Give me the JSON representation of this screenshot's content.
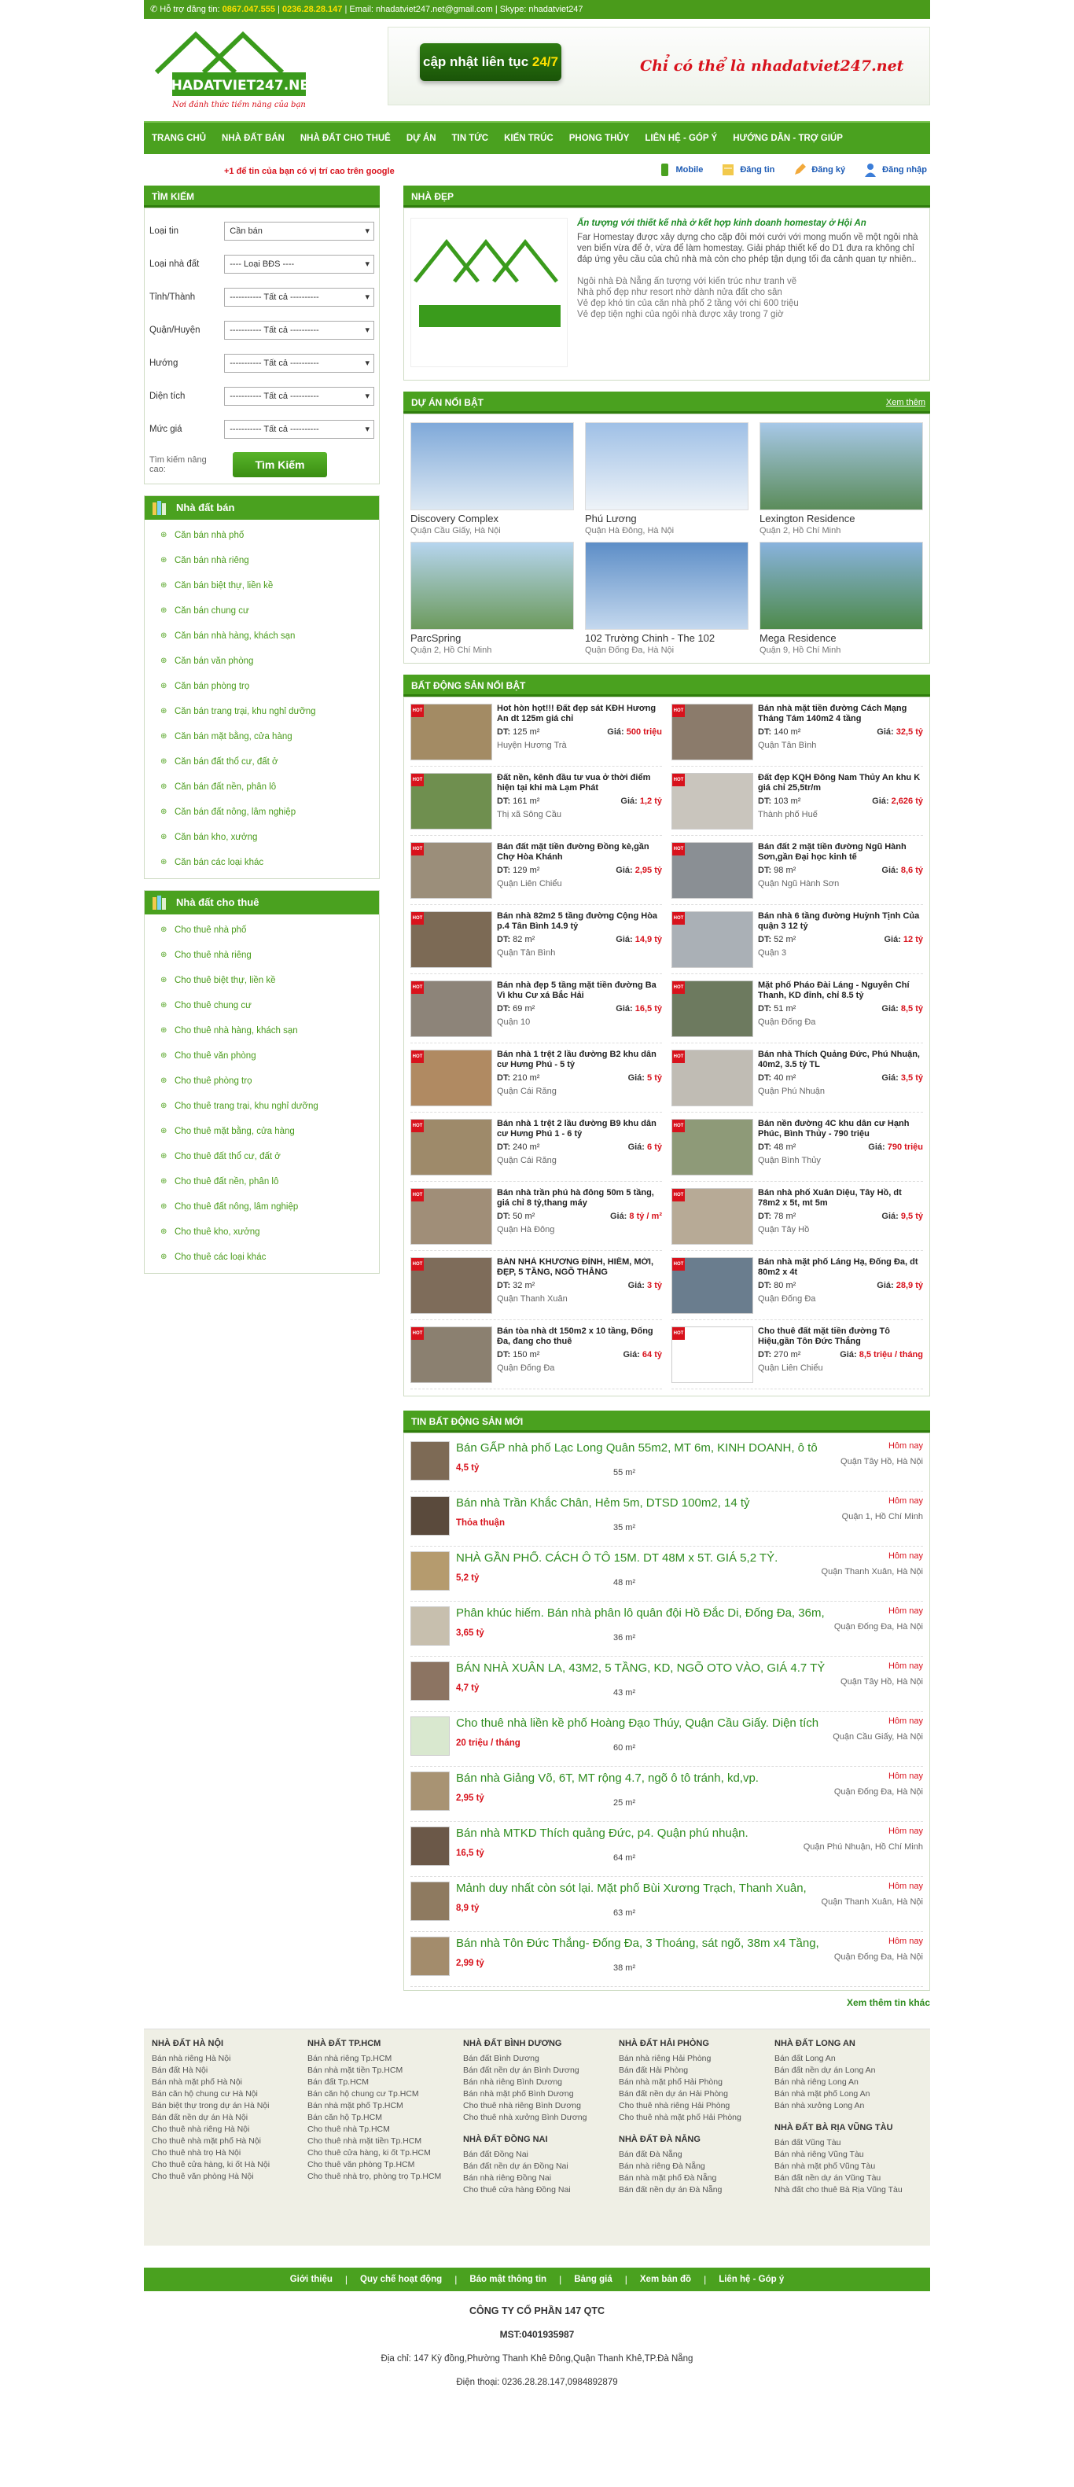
{
  "topbar": {
    "support_label": "Hỗ trợ đăng tin:",
    "phone1": "0867.047.555",
    "sep": "|",
    "phone2": "0236.28.28.147",
    "email": "| Email: nhadatviet247.net@gmail.com",
    "skype": "| Skype: nhadatviet247"
  },
  "header": {
    "logo_text": "NHADATVIET247.NET",
    "logo_tag": "Nơi đánh thức tiềm năng của bạn",
    "banner_btn_prefix": "cập nhật liên tục",
    "banner_btn_hl": "24/7",
    "banner_slogan": "Chỉ có thể là nhadatviet247.net"
  },
  "nav": [
    "TRANG CHỦ",
    "NHÀ ĐẤT BÁN",
    "NHÀ ĐẤT CHO THUÊ",
    "DỰ ÁN",
    "TIN TỨC",
    "KIẾN TRÚC",
    "PHONG THỦY",
    "LIÊN HỆ - GÓP Ý",
    "HƯỚNG DẪN - TRỢ GIÚP"
  ],
  "subbar": {
    "gplus": "+1 để tin của bạn có vị trí cao trên google",
    "mobile": "Mobile",
    "post": "Đăng tin",
    "register": "Đăng ký",
    "login": "Đăng nhập"
  },
  "search": {
    "title": "TÌM KIẾM",
    "rows": [
      {
        "label": "Loại tin",
        "value": "Cần bán"
      },
      {
        "label": "Loại nhà đất",
        "value": "---- Loại BĐS ----"
      },
      {
        "label": "Tỉnh/Thành",
        "value": "----------- Tất cả ----------"
      },
      {
        "label": "Quận/Huyện",
        "value": "----------- Tất cả ----------"
      },
      {
        "label": "Hướng",
        "value": "----------- Tất cả ----------"
      },
      {
        "label": "Diện tích",
        "value": "----------- Tất cả ----------"
      },
      {
        "label": "Mức giá",
        "value": "----------- Tất cả ----------"
      }
    ],
    "advanced": "Tìm kiếm nâng cao:",
    "button": "Tìm Kiếm"
  },
  "sale_cat": {
    "title": "Nhà đất bán",
    "items": [
      "Căn bán nhà phố",
      "Căn bán nhà riêng",
      "Căn bán biệt thự, liền kề",
      "Căn bán chung cư",
      "Căn bán nhà hàng, khách sạn",
      "Căn bán văn phòng",
      "Căn bán phòng trọ",
      "Căn bán trang trại, khu nghỉ dưỡng",
      "Căn bán mặt bằng, cửa hàng",
      "Căn bán đất thổ cư, đất ở",
      "Căn bán đất nền, phân lô",
      "Căn bán đất nông, lâm nghiệp",
      "Căn bán kho, xưởng",
      "Căn bán các loại khác"
    ]
  },
  "rent_cat": {
    "title": "Nhà đất cho thuê",
    "items": [
      "Cho thuê nhà phố",
      "Cho thuê nhà riêng",
      "Cho thuê biệt thự, liền kề",
      "Cho thuê chung cư",
      "Cho thuê nhà hàng, khách sạn",
      "Cho thuê văn phòng",
      "Cho thuê phòng trọ",
      "Cho thuê trang trại, khu nghỉ dưỡng",
      "Cho thuê mặt bằng, cửa hàng",
      "Cho thuê đất thổ cư, đất ở",
      "Cho thuê đất nền, phân lô",
      "Cho thuê đất nông, lâm nghiệp",
      "Cho thuê kho, xưởng",
      "Cho thuê các loại khác"
    ]
  },
  "featured": {
    "title": "NHÀ ĐẸP",
    "headline": "Ấn tượng với thiết kế nhà ở kết hợp kinh doanh homestay ở Hội An",
    "body": "Far Homestay được xây dựng cho cặp đôi mới cưới với mong muốn về một ngôi nhà ven biển vừa để ở, vừa để làm homestay. Giải pháp thiết kế do D1 đưa ra không chỉ đáp ứng yêu cầu của chủ nhà mà còn cho phép tận dụng tối đa cảnh quan tự nhiên..",
    "links": [
      "Ngôi nhà Đà Nẵng ấn tượng với kiến trúc như tranh vẽ",
      "Nhà phố đẹp như resort nhờ dành nửa đất cho sân",
      "Vẻ đẹp khó tin của căn nhà phố 2 tầng với chi 600 triệu",
      "Vẻ đẹp tiện nghi của ngôi nhà được xây trong 7 giờ"
    ]
  },
  "projects": {
    "title": "DỰ ÁN NỔI BẬT",
    "more": "Xem thêm",
    "items": [
      {
        "name": "Discovery Complex",
        "loc": "Quận Cầu Giấy, Hà Nội"
      },
      {
        "name": "Phú Lương",
        "loc": "Quận Hà Đông, Hà Nội"
      },
      {
        "name": "Lexington Residence",
        "loc": "Quận 2, Hồ Chí Minh"
      },
      {
        "name": "ParcSpring",
        "loc": "Quận 2, Hồ Chí Minh"
      },
      {
        "name": "102 Trường Chinh - The 102",
        "loc": "Quận Đống Đa, Hà Nội"
      },
      {
        "name": "Mega Residence",
        "loc": "Quận 9, Hồ Chí Minh"
      }
    ]
  },
  "hot": {
    "title": "BẤT ĐỘNG SẢN NỔI BẬT",
    "badge": "HOT",
    "dt_label": "DT:",
    "price_label": "Giá:",
    "items": [
      {
        "title": "Hot hòn họt!!! Đất đẹp sát KĐH Hương An dt 125m giá chỉ",
        "dt": "125 m²",
        "price": "500 triệu",
        "loc": "Huyện Hương Trà"
      },
      {
        "title": "Bán nhà mặt tiền đường Cách Mạng Tháng Tám 140m2 4 tầng",
        "dt": "140 m²",
        "price": "32,5 tỷ",
        "loc": "Quận Tân Bình"
      },
      {
        "title": "Đất nền, kênh đầu tư vua ở thời điểm hiện tại khi mà Lạm Phát",
        "dt": "161 m²",
        "price": "1,2 tỷ",
        "loc": "Thị xã Sông Cầu"
      },
      {
        "title": "Đất đẹp KQH Đông Nam Thủy An khu K giá chỉ 25,5tr/m",
        "dt": "103 m²",
        "price": "2,626 tỷ",
        "loc": "Thành phố Huế"
      },
      {
        "title": "Bán đất mặt tiền đường Đồng kè,gần Chợ Hòa Khánh",
        "dt": "129 m²",
        "price": "2,95 tỷ",
        "loc": "Quận Liên Chiểu"
      },
      {
        "title": "Bán đất 2 mặt tiền đường Ngũ Hành Sơn,gần Đại học kinh tế",
        "dt": "98 m²",
        "price": "8,6 tỷ",
        "loc": "Quận Ngũ Hành Sơn"
      },
      {
        "title": "Bán nhà 82m2 5 tầng đường Cộng Hòa p.4 Tân Bình 14.9 tỷ",
        "dt": "82 m²",
        "price": "14,9 tỷ",
        "loc": "Quận Tân Bình"
      },
      {
        "title": "Bán nhà 6 tầng đường Huỳnh Tịnh Của quận 3 12 tỷ",
        "dt": "52 m²",
        "price": "12 tỷ",
        "loc": "Quận 3"
      },
      {
        "title": "Bán nhà đẹp 5 tầng mặt tiền đường Ba Vì khu Cư xá Bắc Hải",
        "dt": "69 m²",
        "price": "16,5 tỷ",
        "loc": "Quận 10"
      },
      {
        "title": "Mặt phố Pháo Đài Láng - Nguyễn Chí Thanh, KD đỉnh, chỉ 8.5 tỷ",
        "dt": "51 m²",
        "price": "8,5 tỷ",
        "loc": "Quận Đống Đa"
      },
      {
        "title": "Bán nhà 1 trệt 2 lầu đường B2 khu dân cư Hưng Phú - 5 tỷ",
        "dt": "210 m²",
        "price": "5 tỷ",
        "loc": "Quận Cái Răng"
      },
      {
        "title": "Bán nhà Thích Quảng Đức, Phú Nhuận, 40m2, 3.5 tỷ TL",
        "dt": "40 m²",
        "price": "3,5 tỷ",
        "loc": "Quận Phú Nhuận"
      },
      {
        "title": "Bán nhà 1 trệt 2 lầu đường B9 khu dân cư Hưng Phú 1 - 6 tỷ",
        "dt": "240 m²",
        "price": "6 tỷ",
        "loc": "Quận Cái Răng"
      },
      {
        "title": "Bán nền đường 4C khu dân cư Hạnh Phúc, Bình Thủy - 790 triệu",
        "dt": "48 m²",
        "price": "790 triệu",
        "loc": "Quận Bình Thủy"
      },
      {
        "title": "Bán nhà trần phú hà đông 50m 5 tầng, giá chỉ 8 tỷ,thang máy",
        "dt": "50 m²",
        "price": "8 tỷ / m²",
        "loc": "Quận Hà Đông"
      },
      {
        "title": "Bán nhà phố Xuân Diệu, Tây Hồ, dt 78m2 x 5t, mt 5m",
        "dt": "78 m²",
        "price": "9,5 tỷ",
        "loc": "Quận Tây Hồ"
      },
      {
        "title": "BÁN NHÀ KHƯƠNG ĐÌNH, HIẾM, MỚI, ĐẸP, 5 TẦNG, NGÕ THẲNG",
        "dt": "32 m²",
        "price": "3 tỷ",
        "loc": "Quận Thanh Xuân"
      },
      {
        "title": "Bán nhà mặt phố Láng Hạ, Đống Đa, dt 80m2 x 4t",
        "dt": "80 m²",
        "price": "28,9 tỷ",
        "loc": "Quận Đống Đa"
      },
      {
        "title": "Bán tòa nhà dt 150m2 x 10 tầng, Đống Đa, đang cho thuê",
        "dt": "150 m²",
        "price": "64 tỷ",
        "loc": "Quận Đống Đa"
      },
      {
        "title": "Cho thuê đất mặt tiền đường Tô Hiệu,gần Tôn Đức Thắng",
        "dt": "270 m²",
        "price": "8,5 triệu / tháng",
        "loc": "Quận Liên Chiểu"
      }
    ]
  },
  "news": {
    "title": "TIN BẤT ĐỘNG SẢN MỚI",
    "more": "Xem thêm tin khác",
    "items": [
      {
        "title": "Bán GẤP nhà phố Lạc Long Quân 55m2, MT 6m, KINH DOANH, ô tô",
        "price": "4,5 tỷ",
        "area": "55 m²",
        "date": "Hôm nay",
        "loc": "Quận Tây Hồ, Hà Nội"
      },
      {
        "title": "Bán nhà Trần Khắc Chân, Hẻm 5m, DTSD 100m2, 14 tỷ",
        "price": "Thỏa thuận",
        "area": "35 m²",
        "date": "Hôm nay",
        "loc": "Quận 1, Hồ Chí Minh"
      },
      {
        "title": "NHÀ GẦN PHỐ. CÁCH Ô TÔ 15M. DT 48M x 5T. GIÁ 5,2 TỶ.",
        "price": "5,2 tỷ",
        "area": "48 m²",
        "date": "Hôm nay",
        "loc": "Quận Thanh Xuân, Hà Nội"
      },
      {
        "title": "Phân khúc hiếm. Bán nhà phân lô quân đội Hồ Đắc Di, Đống Đa, 36m,",
        "price": "3,65 tỷ",
        "area": "36 m²",
        "date": "Hôm nay",
        "loc": "Quận Đống Đa, Hà Nội"
      },
      {
        "title": "BÁN NHÀ XUÂN LA, 43M2, 5 TẦNG, KD, NGÕ OTO VÀO, GIÁ 4.7 TỶ",
        "price": "4,7 tỷ",
        "area": "43 m²",
        "date": "Hôm nay",
        "loc": "Quận Tây Hồ, Hà Nội"
      },
      {
        "title": "Cho thuê nhà liền kề phố Hoàng Đạo Thúy, Quận Cầu Giấy. Diện tích",
        "price": "20 triệu / tháng",
        "area": "60 m²",
        "date": "Hôm nay",
        "loc": "Quận Cầu Giấy, Hà Nội"
      },
      {
        "title": "Bán nhà Giảng Võ, 6T, MT rộng 4.7, ngõ ô tô tránh, kd,vp.",
        "price": "2,95 tỷ",
        "area": "25 m²",
        "date": "Hôm nay",
        "loc": "Quận Đống Đa, Hà Nội"
      },
      {
        "title": "Bán nhà MTKD Thích quảng Đức, p4. Quận phú nhuận.",
        "price": "16,5 tỷ",
        "area": "64 m²",
        "date": "Hôm nay",
        "loc": "Quận Phú Nhuận, Hồ Chí Minh"
      },
      {
        "title": "Mảnh duy nhất còn sót lại. Mặt phố Bùi Xương Trạch, Thanh Xuân,",
        "price": "8,9 tỷ",
        "area": "63 m²",
        "date": "Hôm nay",
        "loc": "Quận Thanh Xuân, Hà Nội"
      },
      {
        "title": "Bán nhà Tôn Đức Thắng- Đống Đa, 3 Thoáng, sát ngõ, 38m x4 Tầng,",
        "price": "2,99 tỷ",
        "area": "38 m²",
        "date": "Hôm nay",
        "loc": "Quận Đống Đa, Hà Nội"
      }
    ]
  },
  "footer_links": [
    {
      "groups": [
        {
          "title": "NHÀ ĐẤT HÀ NỘI",
          "items": [
            "Bán nhà riêng Hà Nội",
            "Bán đất Hà Nội",
            "Bán nhà mặt phố Hà Nội",
            "Bán căn hộ chung cư Hà Nội",
            "Bán biệt thự trong dự án Hà Nội",
            "Bán đất nền dự án Hà Nội",
            "Cho thuê nhà riêng Hà Nội",
            "Cho thuê nhà mặt phố Hà Nội",
            "Cho thuê nhà trọ Hà Nội",
            "Cho thuê cửa hàng, ki ốt Hà Nội",
            "Cho thuê văn phòng Hà Nội"
          ]
        }
      ]
    },
    {
      "groups": [
        {
          "title": "NHÀ ĐẤT TP.HCM",
          "items": [
            "Bán nhà riêng Tp.HCM",
            "Bán nhà mặt tiền Tp.HCM",
            "Bán đất Tp.HCM",
            "Bán căn hộ chung cư Tp.HCM",
            "Bán nhà mặt phố Tp.HCM",
            "Bán căn hộ Tp.HCM",
            "Cho thuê nhà Tp.HCM",
            "Cho thuê nhà mặt tiền Tp.HCM",
            "Cho thuê cửa hàng, ki ốt Tp.HCM",
            "Cho thuê văn phòng Tp.HCM",
            "Cho thuê nhà trọ, phòng trọ Tp.HCM"
          ]
        }
      ]
    },
    {
      "groups": [
        {
          "title": "NHÀ ĐẤT BÌNH DƯƠNG",
          "items": [
            "Bán đất Bình Dương",
            "Bán đất nền dự án Bình Dương",
            "Bán nhà riêng Bình Dương",
            "Bán nhà mặt phố Bình Dương",
            "Cho thuê nhà riêng Bình Dương",
            "Cho thuê nhà xưởng Bình Dương"
          ]
        },
        {
          "title": "NHÀ ĐẤT ĐỒNG NAI",
          "items": [
            "Bán đất Đồng Nai",
            "Bán đất nền dự án Đồng Nai",
            "Bán nhà riêng Đồng Nai",
            "Cho thuê cửa hàng Đồng Nai"
          ]
        }
      ]
    },
    {
      "groups": [
        {
          "title": "NHÀ ĐẤT HẢI PHÒNG",
          "items": [
            "Bán nhà riêng Hải Phòng",
            "Bán đất Hải Phòng",
            "Bán nhà mặt phố Hải Phòng",
            "Bán đất nền dự án Hải Phòng",
            "Cho thuê nhà riêng Hải Phòng",
            "Cho thuê nhà mặt phố Hải Phòng"
          ]
        },
        {
          "title": "NHÀ ĐẤT ĐÀ NẴNG",
          "items": [
            "Bán đất Đà Nẵng",
            "Bán nhà riêng Đà Nẵng",
            "Bán nhà mặt phố Đà Nẵng",
            "Bán đất nền dự án Đà Nẵng"
          ]
        }
      ]
    },
    {
      "groups": [
        {
          "title": "NHÀ ĐẤT LONG AN",
          "items": [
            "Bán đất Long An",
            "Bán đất nền dự án Long An",
            "Bán nhà riêng Long An",
            "Bán nhà mặt phố Long An",
            "Bán nhà xưởng Long An"
          ]
        },
        {
          "title": "NHÀ ĐẤT BÀ RỊA VŨNG TÀU",
          "items": [
            "Bán đất Vũng Tàu",
            "Bán nhà riêng Vũng Tàu",
            "Bán nhà mặt phố Vũng Tàu",
            "Bán đất nền dự án Vũng Tàu",
            "Nhà đất cho thuê Bà Rịa Vũng Tàu"
          ]
        }
      ]
    }
  ],
  "bottomnav": [
    "Giới thiệu",
    "Quy chế hoạt động",
    "Báo mật thông tin",
    "Bảng giá",
    "Xem bản đồ",
    "Liên hệ - Góp ý"
  ],
  "company": {
    "name": "CÔNG TY CỔ PHẦN 147 QTC",
    "tax": "MST:0401935987",
    "address": "Địa chỉ: 147 Kỳ đồng,Phường Thanh Khê Đông,Quận Thanh Khê,TP.Đà Nẵng",
    "phone": "Điện thoại: 0236.28.28.147,0984892879"
  },
  "colors": {
    "brand_green": "#4aa11f",
    "price_red": "#d8121c",
    "link_green": "#2f8c1f"
  }
}
